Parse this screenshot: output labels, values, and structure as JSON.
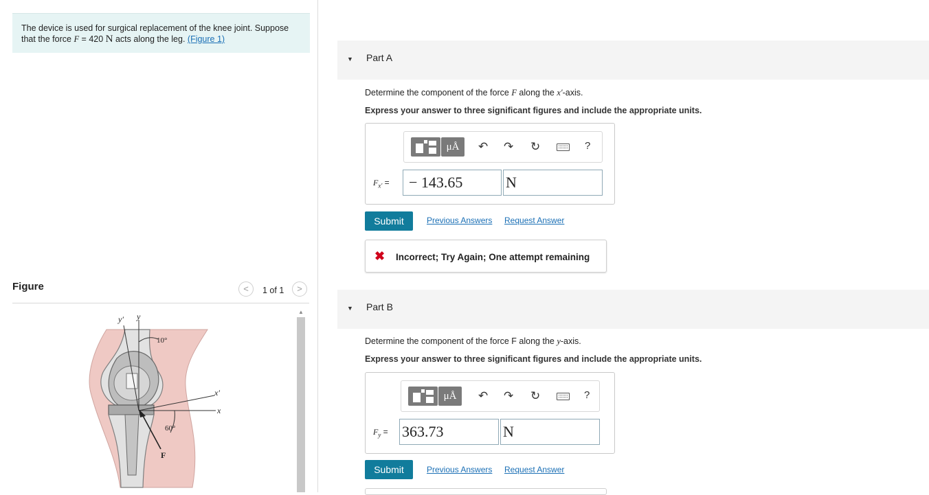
{
  "problem": {
    "text_before_F": "The device is used for surgical replacement of the knee joint. Suppose that the force ",
    "force_symbol": "F",
    "equals": " = 420 ",
    "unit": "N",
    "text_after": " acts along the leg. ",
    "figure_link": "(Figure 1)"
  },
  "figure_panel": {
    "title": "Figure",
    "pager_prev": "<",
    "pager_text": "1 of 1",
    "pager_next": ">",
    "labels": {
      "y_prime": "y′",
      "y": "y",
      "angle_top": "10°",
      "x_prime": "x′",
      "x": "x",
      "angle_bottom": "60°",
      "force": "F"
    }
  },
  "part_a": {
    "title": "Part A",
    "question_prefix": "Determine the component of the force ",
    "question_var": "F",
    "question_mid": " along the ",
    "question_axis": "x′",
    "question_suffix": "-axis.",
    "express": "Express your answer to three significant figures and include the appropriate units.",
    "toolbar": {
      "mu": "μÅ",
      "help": "?"
    },
    "var_label": "F",
    "var_sub": "x′",
    "equals": " =",
    "value": "− 143.65",
    "unit": "N",
    "submit": "Submit",
    "prev_answers": "Previous Answers",
    "request_answer": "Request Answer",
    "feedback": "Incorrect; Try Again; One attempt remaining"
  },
  "part_b": {
    "title": "Part B",
    "question_prefix": "Determine the component of the force F along the ",
    "question_axis": "y",
    "question_suffix": "-axis.",
    "express": "Express your answer to three significant figures and include the appropriate units.",
    "toolbar": {
      "mu": "μÅ",
      "help": "?"
    },
    "var_label": "F",
    "var_sub": "y",
    "equals": " =",
    "value": "363.73",
    "unit": "N",
    "submit": "Submit",
    "prev_answers": "Previous Answers",
    "request_answer": "Request Answer"
  },
  "colors": {
    "problem_bg": "#e6f4f4",
    "submit_bg": "#117c9c",
    "link": "#1a6fb5",
    "error": "#d0021b",
    "part_header_bg": "#f4f4f4"
  }
}
